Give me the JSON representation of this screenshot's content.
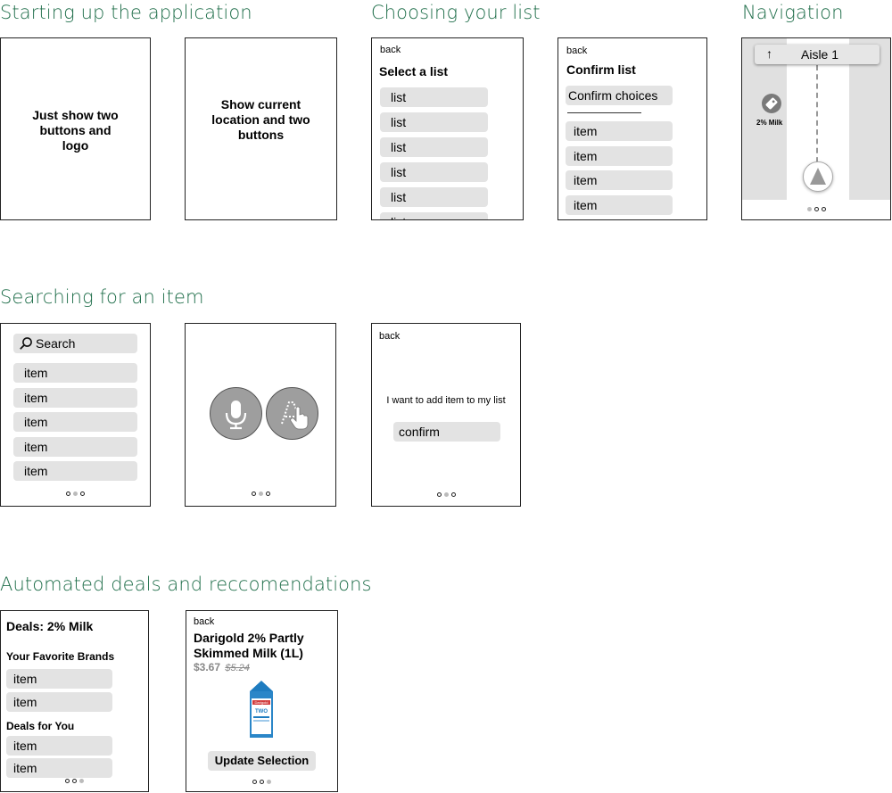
{
  "sections": {
    "startup": "Starting up the application",
    "choosing": "Choosing your list",
    "navigation": "Navigation",
    "searching": "Searching for an item",
    "deals": "Automated deals and reccomendations"
  },
  "startup1": {
    "text": "Just show two buttons and logo"
  },
  "startup2": {
    "text": "Show current location and two buttons"
  },
  "selectList": {
    "back": "back",
    "title": "Select a list",
    "items": [
      "list",
      "list",
      "list",
      "list",
      "list",
      "list"
    ]
  },
  "confirmList": {
    "back": "back",
    "title": "Confirm list",
    "confirm": "Confirm choices",
    "items": [
      "item",
      "item",
      "item",
      "item"
    ]
  },
  "nav": {
    "aisle": "Aisle 1",
    "arrow": "↑",
    "tag_label": "2% Milk",
    "icons": [
      "tag-icon",
      "arrow-up-icon",
      "location-arrow-icon"
    ]
  },
  "search": {
    "placeholder": "Search",
    "items": [
      "item",
      "item",
      "item",
      "item",
      "item"
    ]
  },
  "voice": {
    "icons": [
      "microphone-icon",
      "tap-gesture-icon"
    ]
  },
  "addItem": {
    "back": "back",
    "message": "I want to add item to my list",
    "confirm": "confirm"
  },
  "dealsScreen": {
    "title": "Deals: 2% Milk",
    "favHeading": "Your Favorite Brands",
    "favItems": [
      "item",
      "item"
    ],
    "dealsHeading": "Deals for You",
    "dealItems": [
      "item",
      "item"
    ]
  },
  "product": {
    "back": "back",
    "name": "Darigold 2% Partly Skimmed Milk (1L)",
    "price": "$3.67",
    "oldPrice": "$5.24",
    "button": "Update Selection",
    "carton_brand": "Darigold",
    "carton_text": "TWO"
  },
  "colors": {
    "accent": "#1f6e4a",
    "pill": "#e3e3e3"
  }
}
